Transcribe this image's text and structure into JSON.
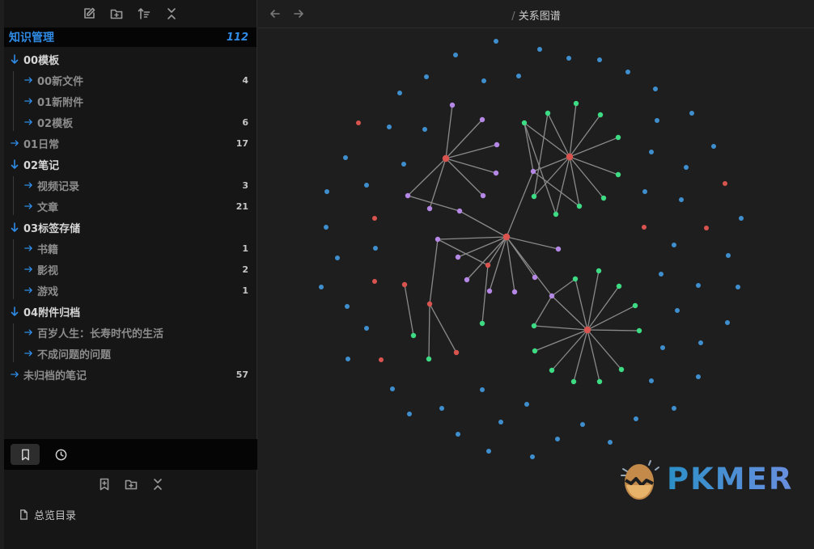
{
  "sidebar": {
    "vault_name": "知识管理",
    "vault_count": "112",
    "tree": [
      {
        "label": "00模板",
        "count": "",
        "expanded": true,
        "children": [
          {
            "label": "00新文件",
            "count": "4"
          },
          {
            "label": "01新附件",
            "count": ""
          },
          {
            "label": "02模板",
            "count": "6"
          }
        ]
      },
      {
        "label": "01日常",
        "count": "17",
        "expanded": false,
        "children": []
      },
      {
        "label": "02笔记",
        "count": "",
        "expanded": true,
        "children": [
          {
            "label": "视频记录",
            "count": "3"
          },
          {
            "label": "文章",
            "count": "21"
          }
        ]
      },
      {
        "label": "03标签存储",
        "count": "",
        "expanded": true,
        "children": [
          {
            "label": "书籍",
            "count": "1"
          },
          {
            "label": "影视",
            "count": "2"
          },
          {
            "label": "游戏",
            "count": "1"
          }
        ]
      },
      {
        "label": "04附件归档",
        "count": "",
        "expanded": true,
        "children": [
          {
            "label": "百岁人生：长寿时代的生活",
            "count": ""
          },
          {
            "label": "不成问题的问题",
            "count": ""
          }
        ]
      },
      {
        "label": "未归档的笔记",
        "count": "57",
        "expanded": false,
        "children": []
      }
    ],
    "bookmark_item": "总览目录"
  },
  "header": {
    "breadcrumb_sep": "/",
    "title": "关系图谱"
  },
  "logo_text": "PKMER",
  "colors": {
    "accent": "#2f8be6",
    "node_blue": "#3f8fcf",
    "node_red": "#d9534f",
    "node_green": "#3ddc84",
    "node_purple": "#b588e6",
    "edge": "#8a8a8a"
  }
}
